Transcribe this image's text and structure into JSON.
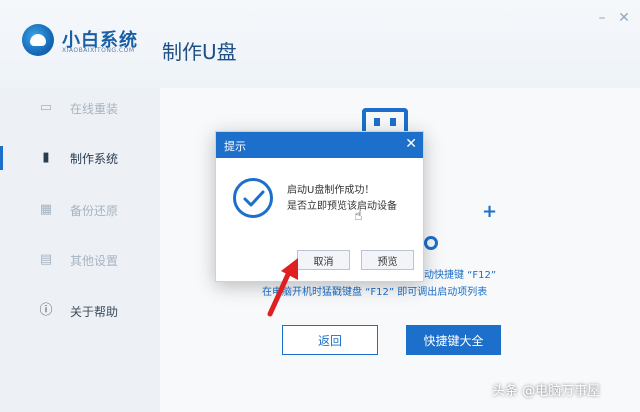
{
  "app": {
    "brand_name": "小白系统",
    "brand_sub": "XIAOBAIXITONG.COM",
    "page_title": "制作U盘"
  },
  "window_controls": {
    "minimize": "–",
    "close": "✕"
  },
  "sidebar": {
    "items": [
      {
        "label": "在线重装",
        "icon": "monitor-icon"
      },
      {
        "label": "制作系统",
        "icon": "usb-icon"
      },
      {
        "label": "备份还原",
        "icon": "backup-icon"
      },
      {
        "label": "其他设置",
        "icon": "briefcase-icon"
      },
      {
        "label": "关于帮助",
        "icon": "info-icon"
      }
    ],
    "active": "制作系统"
  },
  "background": {
    "line1": "动快捷键 “F12”",
    "line2": "在电脑开机时猛戳键盘 “F12” 即可调出启动项列表"
  },
  "buttons": {
    "back": "返回",
    "shortcut": "快捷键大全"
  },
  "dialog": {
    "title": "提示",
    "message_line1": "启动U盘制作成功！",
    "message_line2": "是否立即预览该启动设备",
    "cancel": "取消",
    "preview": "预览"
  },
  "watermark": "头条 @电脑万事屋",
  "colors": {
    "accent": "#1c6fca",
    "annotation_arrow": "#e02020"
  }
}
